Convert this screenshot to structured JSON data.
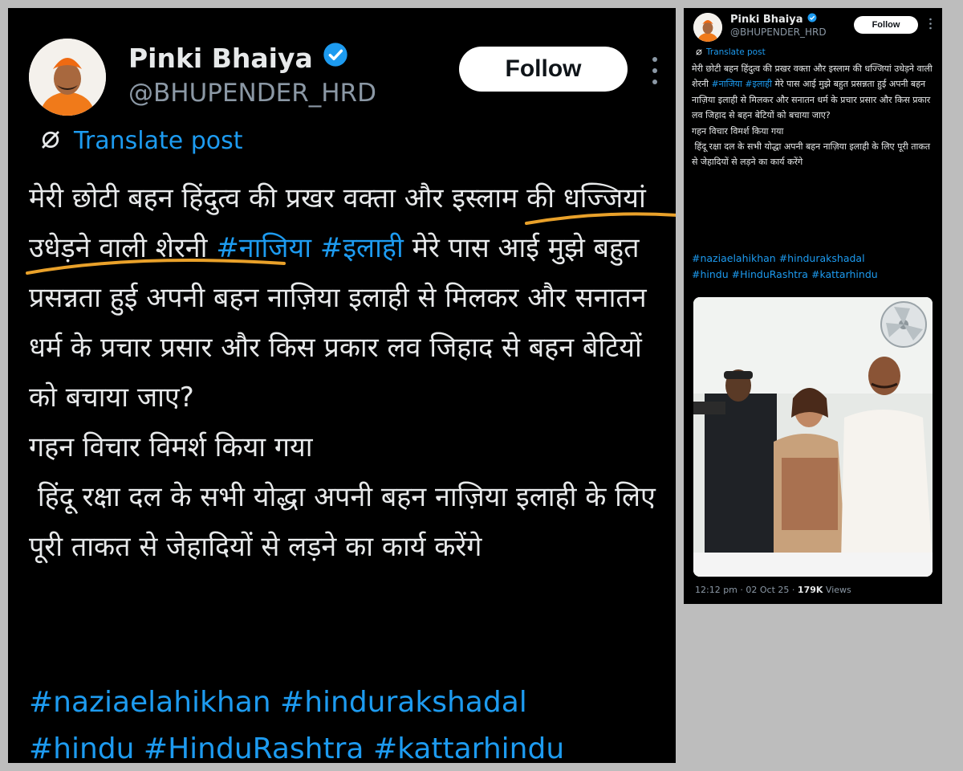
{
  "post": {
    "author_name": "Pinki Bhaiya",
    "handle": "@BHUPENDER_HRD",
    "follow_label": "Follow",
    "translate_label": "Translate post",
    "body_text": "मेरी छोटी बहन हिंदुत्व की प्रखर वक्ता और इस्लाम की धज्जियां उधेड़ने वाली शेरनी",
    "hashtag_nazia": "#नाजिया",
    "hashtag_elahi": "#इलाही",
    "body_text_2": "मेरे पास आई मुझे बहुत प्रसन्नता हुई अपनी बहन नाज़िया इलाही से मिलकर और सनातन धर्म के प्रचार प्रसार और किस प्रकार लव जिहाद से बहन बेटियों को बचाया जाए?\nगहन विचार विमर्श किया गया\n हिंदू रक्षा दल के सभी योद्धा अपनी बहन नाज़िया इलाही के लिए पूरी ताकत से जेहादियों से लड़ने का कार्य करेंगे",
    "hashtags": [
      "#naziaelahikhan",
      "#hindurakshadal",
      "#hindu",
      "#HinduRashtra",
      "#kattarhindu"
    ],
    "time": "12:12 pm",
    "date": "02 Oct 25",
    "views_count": "179K",
    "views_label": "Views"
  },
  "icons": {
    "verified": "verified-badge-icon",
    "translate": "translate-globe-icon",
    "more": "more-options-icon"
  },
  "colors": {
    "background": "#000000",
    "text": "#e7e9ea",
    "link": "#1d9bf0",
    "secondary": "#8b98a5",
    "highlight_underline": "#e9a12a"
  }
}
